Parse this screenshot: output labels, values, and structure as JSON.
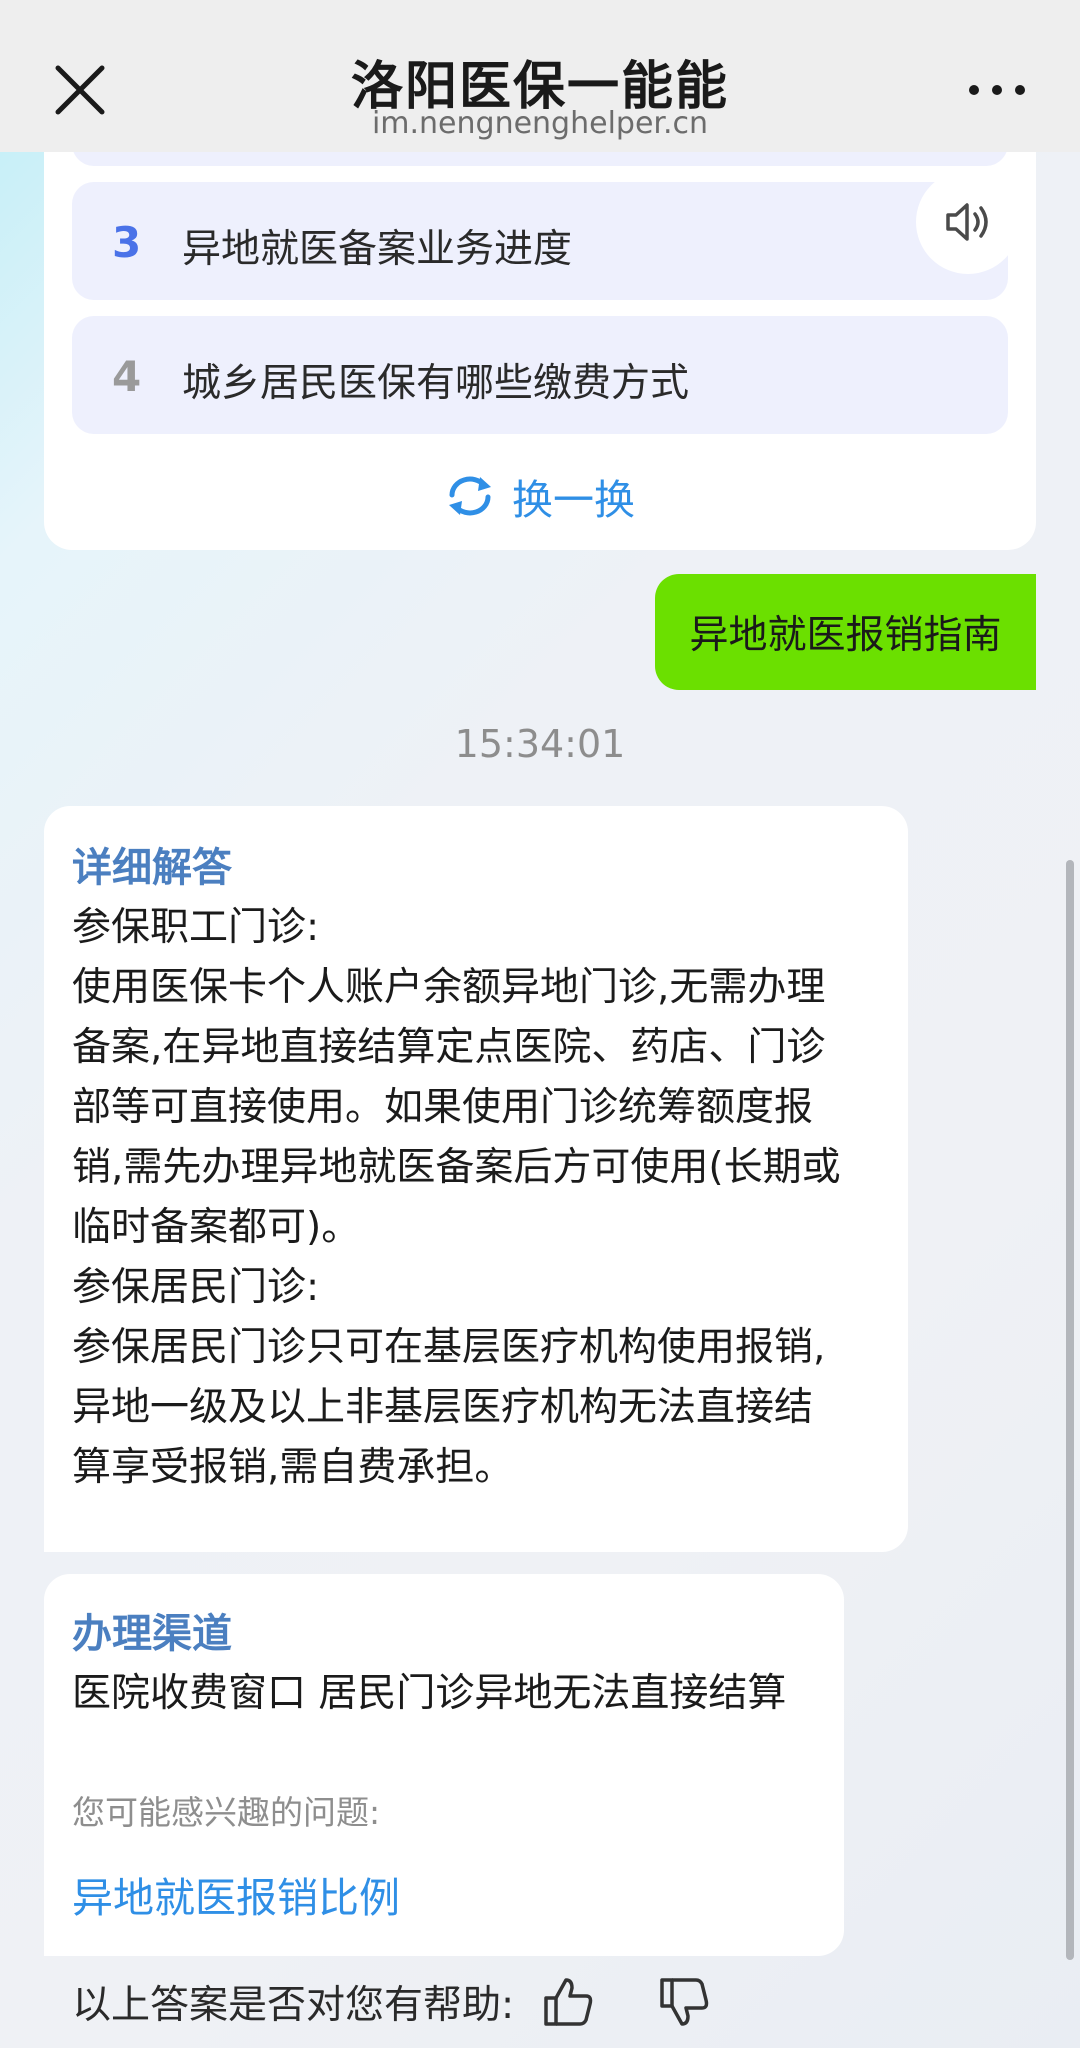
{
  "header": {
    "title": "洛阳医保一能能",
    "subtitle": "im.nengnenghelper.cn"
  },
  "suggestions": {
    "items": [
      {
        "number": "3",
        "text": "异地就医备案业务进度"
      },
      {
        "number": "4",
        "text": "城乡居民医保有哪些缴费方式"
      }
    ],
    "refresh_label": "换一换"
  },
  "user_message": "异地就医报销指南",
  "timestamp": "15:34:01",
  "answer": {
    "title": "详细解答",
    "lines": [
      "参保职工门诊:",
      "使用医保卡个人账户余额异地门诊,无需办理",
      "备案,在异地直接结算定点医院、药店、门诊",
      "部等可直接使用。如果使用门诊统筹额度报",
      "销,需先办理异地就医备案后方可使用(长期或",
      "临时备案都可)。",
      "参保居民门诊:",
      "参保居民门诊只可在基层医疗机构使用报销,",
      "异地一级及以上非基层医疗机构无法直接结",
      "算享受报销,需自费承担。"
    ]
  },
  "channel": {
    "title": "办理渠道",
    "text": "医院收费窗口 居民门诊异地无法直接结算",
    "maybe_label": "您可能感兴趣的问题:",
    "maybe_link": "异地就医报销比例"
  },
  "feedback": {
    "question": "以上答案是否对您有帮助:"
  },
  "colors": {
    "accent_blue": "#2f8fe6",
    "section_title": "#4b7fc0",
    "user_bubble": "#6be000"
  },
  "icons": [
    "close-icon",
    "more-icon",
    "speaker-icon",
    "refresh-icon",
    "thumbs-up-icon",
    "thumbs-down-icon"
  ]
}
